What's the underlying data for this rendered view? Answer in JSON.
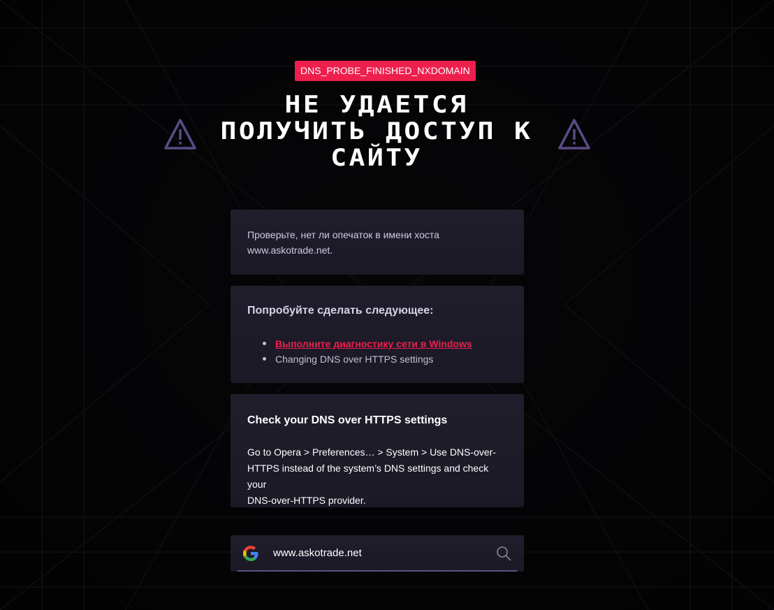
{
  "error": {
    "code": "DNS_PROBE_FINISHED_NXDOMAIN",
    "headline_lines": [
      "НЕ УДАЕТСЯ",
      "ПОЛУЧИТЬ ДОСТУП К",
      "САЙТУ"
    ]
  },
  "cards": {
    "hostname_check": {
      "line1": "Проверьте, нет ли опечаток в имени хоста",
      "line2": "www.askotrade.net."
    },
    "try_next": {
      "title": "Попробуйте сделать следующее:",
      "items": [
        {
          "label": "Выполните диагностику сети в Windows",
          "link": true
        },
        {
          "label": "Changing DNS over HTTPS settings",
          "link": false
        }
      ]
    },
    "doh": {
      "title": "Check your DNS over HTTPS settings",
      "lines": [
        "Go to Opera > Preferences… > System > Use DNS-over-",
        "HTTPS instead of the system’s DNS settings and check your",
        "DNS-over-HTTPS provider."
      ]
    }
  },
  "search": {
    "engine_icon": "google-g-icon",
    "value": "www.askotrade.net",
    "icon": "search-icon"
  },
  "icons": {
    "warning": "warning-triangle-icon"
  },
  "colors": {
    "accent": "#ee1f4d",
    "background": "#060608",
    "card": "#1e1b28",
    "warning_icon": "#5a4b86",
    "search_underline": "#5e5480"
  }
}
